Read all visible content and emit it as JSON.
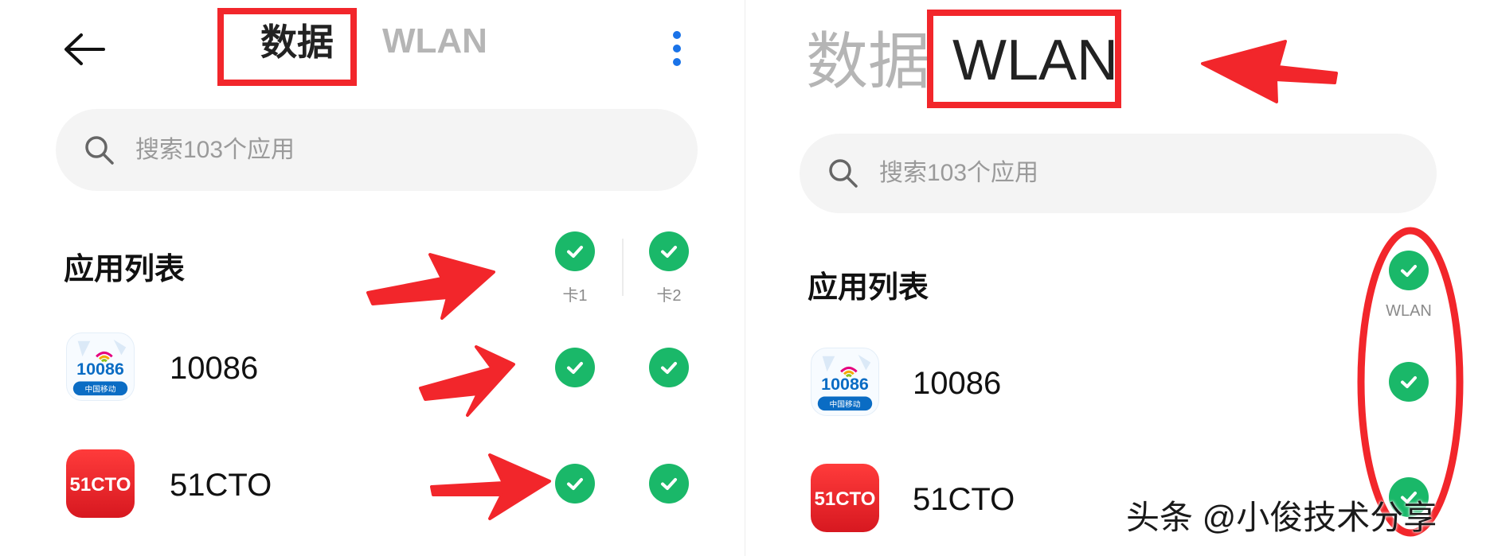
{
  "left": {
    "tabs": [
      {
        "label": "数据",
        "active": true
      },
      {
        "label": "WLAN",
        "active": false
      }
    ],
    "search_placeholder": "搜索103个应用",
    "section_title": "应用列表",
    "columns": [
      "卡1",
      "卡2"
    ],
    "apps": [
      {
        "name": "10086"
      },
      {
        "name": "51CTO"
      }
    ]
  },
  "right": {
    "tabs": [
      {
        "label": "数据",
        "active": false
      },
      {
        "label": "WLAN",
        "active": true
      }
    ],
    "search_placeholder": "搜索103个应用",
    "section_title": "应用列表",
    "columns": [
      "WLAN"
    ],
    "apps": [
      {
        "name": "10086"
      },
      {
        "name": "51CTO"
      }
    ]
  },
  "icons": {
    "back": "arrow-left-icon",
    "menu": "more-vertical-icon",
    "search": "search-icon",
    "check": "check-circle-icon"
  },
  "app_icon_text": {
    "cmcc_number": "10086",
    "cmcc_caption": "中国移动",
    "cto": "51CTO"
  },
  "watermark": "头条 @小俊技术分享",
  "colors": {
    "check_green": "#1ab869",
    "annotation_red": "#f2262b",
    "menu_blue": "#1a73e8"
  }
}
